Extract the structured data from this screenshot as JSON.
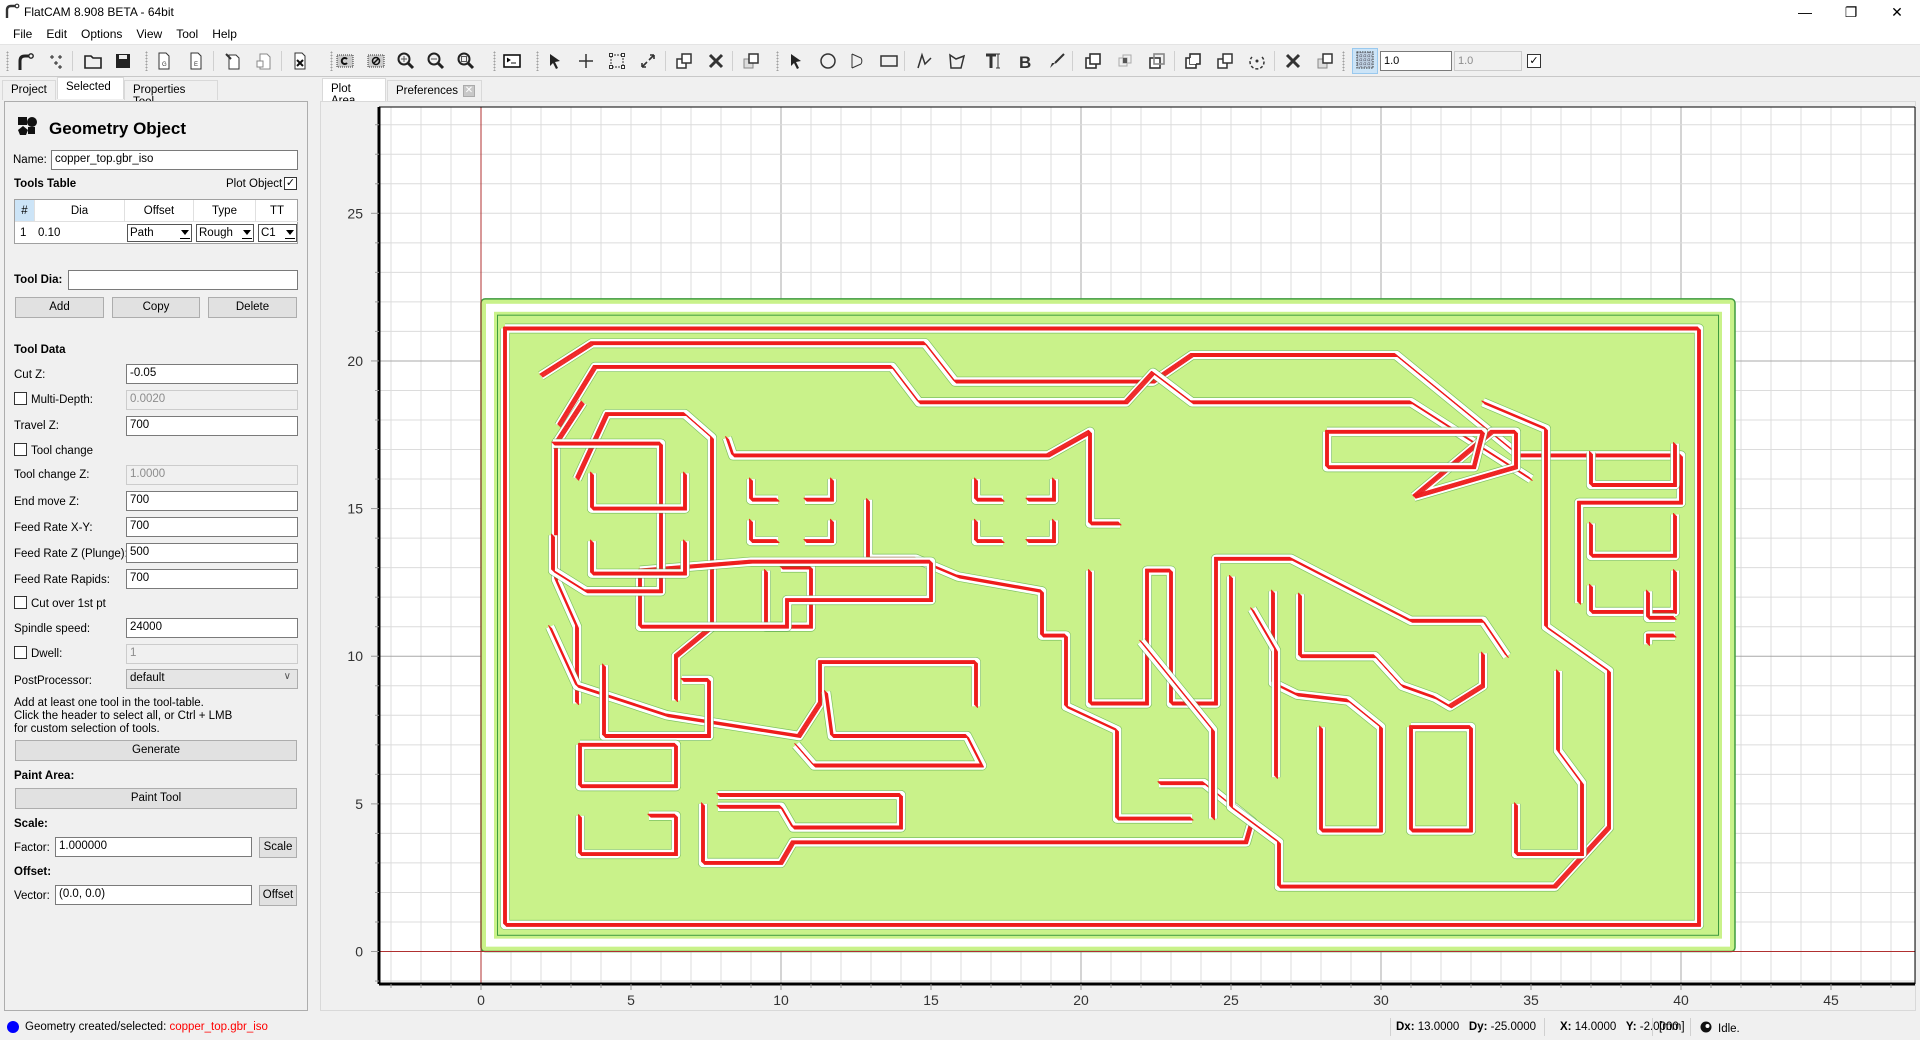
{
  "window": {
    "title": "FlatCAM 8.908 BETA - 64bit",
    "controls": [
      "minimize",
      "restore",
      "close"
    ]
  },
  "menu": [
    "File",
    "Edit",
    "Options",
    "View",
    "Tool",
    "Help"
  ],
  "toolbar": {
    "groups": [
      [
        "new-geometry-icon",
        "new-excellon-icon"
      ],
      [
        "open-project-icon",
        "save-project-icon"
      ],
      [
        "open-gerber-icon",
        "open-excellon-icon",
        "open-gcode-icon",
        "new-document-icon"
      ],
      [
        "delete-object-icon"
      ],
      [
        "replot-icon",
        "clear-plot-icon",
        "zoom-in-icon",
        "zoom-out-icon",
        "zoom-fit-icon"
      ],
      [
        "shell-icon"
      ],
      [
        "select-icon",
        "add-point-icon",
        "resize-icon",
        "move-icon",
        "copy-icon",
        "delete-icon",
        "transform-icon"
      ],
      [
        "select-shape-icon",
        "circle-icon",
        "arc-icon",
        "rectangle-icon",
        "path-icon",
        "polygon-icon",
        "text-icon",
        "buffer-icon",
        "paint-icon",
        "union-icon",
        "intersection-icon",
        "subtraction-icon",
        "cut-icon",
        "copy-shape-icon",
        "rotate-icon",
        "delete-shape-icon",
        "transform-shape-icon"
      ]
    ],
    "grid_snap_active": true,
    "grid_x": "1.0",
    "grid_y": "1.0",
    "grid_link_checked": true
  },
  "left_tabs": [
    {
      "label": "Project",
      "active": false
    },
    {
      "label": "Selected",
      "active": true
    },
    {
      "label": "Properties Tool",
      "active": false
    }
  ],
  "selected": {
    "header": "Geometry Object",
    "name_label": "Name:",
    "name_value": "copper_top.gbr_iso",
    "tools_table_label": "Tools Table",
    "plot_object_label": "Plot Object",
    "plot_object_checked": true,
    "table": {
      "headers": [
        "#",
        "Dia",
        "Offset",
        "Type",
        "TT"
      ],
      "rows": [
        {
          "num": "1",
          "dia": "0.10",
          "offset": "Path",
          "type": "Rough",
          "tt": "C1"
        }
      ]
    },
    "tool_dia_label": "Tool Dia:",
    "tool_dia_value": "",
    "buttons": {
      "add": "Add",
      "copy": "Copy",
      "delete": "Delete"
    },
    "tool_data_label": "Tool Data",
    "fields": {
      "cut_z": {
        "label": "Cut Z:",
        "value": "-0.05"
      },
      "multi_depth": {
        "label": "Multi-Depth:",
        "value": "0.0020",
        "checked": false
      },
      "travel_z": {
        "label": "Travel Z:",
        "value": "700"
      },
      "tool_change": {
        "label": "Tool change",
        "checked": false
      },
      "tool_change_z": {
        "label": "Tool change Z:",
        "value": "1.0000"
      },
      "end_move_z": {
        "label": "End move Z:",
        "value": "700"
      },
      "feed_xy": {
        "label": "Feed Rate X-Y:",
        "value": "700"
      },
      "feed_z": {
        "label": "Feed Rate Z (Plunge):",
        "value": "500"
      },
      "feed_rapids": {
        "label": "Feed Rate Rapids:",
        "value": "700"
      },
      "cut_over": {
        "label": "Cut over 1st pt",
        "checked": false
      },
      "spindle": {
        "label": "Spindle speed:",
        "value": "24000"
      },
      "dwell": {
        "label": "Dwell:",
        "value": "1",
        "checked": false
      },
      "postprocessor": {
        "label": "PostProcessor:",
        "value": "default"
      }
    },
    "hint_lines": [
      "Add at least one tool in the tool-table.",
      "Click the header to select all, or Ctrl + LMB",
      "for custom selection of tools."
    ],
    "generate_label": "Generate",
    "paint_area_label": "Paint Area:",
    "paint_tool_label": "Paint Tool",
    "scale_label": "Scale:",
    "factor_label": "Factor:",
    "factor_value": "1.000000",
    "scale_button": "Scale",
    "offset_label": "Offset:",
    "vector_label": "Vector:",
    "vector_value": "(0.0, 0.0)",
    "offset_button": "Offset"
  },
  "plot_tabs": [
    {
      "label": "Plot Area",
      "active": true
    },
    {
      "label": "Preferences",
      "active": false,
      "closable": true
    }
  ],
  "plot": {
    "x_ticks": [
      "0",
      "5",
      "10",
      "15",
      "20",
      "25",
      "30",
      "35",
      "40",
      "45"
    ],
    "y_ticks": [
      "0",
      "5",
      "10",
      "15",
      "20",
      "25"
    ],
    "x_range_mm": [
      -3.4,
      47.8
    ],
    "y_range_mm": [
      -1.1,
      28.6
    ],
    "board_mm": [
      0,
      0,
      41.8,
      22.1
    ],
    "colors": {
      "board_fill": "#c9f28a",
      "board_stroke": "#3f9b3f",
      "iso_paths": "#ee1c1c",
      "axis_origin": "#b03030",
      "grid": "#dcdcdc",
      "grid_major": "#a8a8a8"
    }
  },
  "status": {
    "message_prefix": "Geometry created/selected:",
    "message_object": "copper_top.gbr_iso",
    "indicator_color": "#0000ff",
    "dx_label": "Dx:",
    "dx": "13.0000",
    "dy_label": "Dy:",
    "dy": "-25.0000",
    "x_label": "X:",
    "x": "14.0000",
    "y_label": "Y:",
    "y": "-2.0000",
    "units": "[mm]",
    "state": "Idle."
  }
}
